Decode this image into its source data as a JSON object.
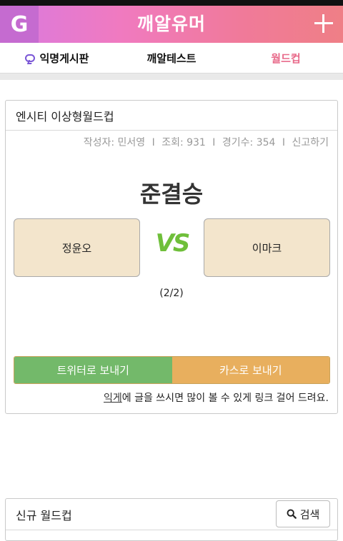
{
  "app": {
    "logo": "G",
    "title": "깨알유머",
    "add_icon": "plus-icon"
  },
  "tabs": [
    {
      "label": "익명게시판",
      "icon": "chat-bubble-icon",
      "active": false
    },
    {
      "label": "깨알테스트",
      "active": false
    },
    {
      "label": "월드컵",
      "active": true
    }
  ],
  "worldcup": {
    "title": "엔시티 이상형월드컵",
    "meta": {
      "author": "작성자: 민서영",
      "views": "조회: 931",
      "matches": "경기수: 354",
      "report": "신고하기",
      "separator": "I"
    },
    "round": "준결승",
    "left_candidate": "정윤오",
    "vs": "VS",
    "right_candidate": "이마크",
    "progress": "(2/2)",
    "share_twitter": "트위터로 보내기",
    "share_kakao": "카스로 보내기",
    "note_link": "익게",
    "note_rest": "에 글을 쓰시면 많이 볼 수 있게 링크 걸어 드려요."
  },
  "new_worldcup": {
    "title": "신규 월드컵",
    "search_label": "검색"
  },
  "colors": {
    "header_gradient_start": "#d97ae0",
    "header_gradient_end": "#ef7f86",
    "active_tab": "#e86a8a",
    "vs": "#6fbf3a",
    "twitter": "#73b96a",
    "kakao": "#e8af5e",
    "candidate_bg": "#f3e5cc"
  }
}
